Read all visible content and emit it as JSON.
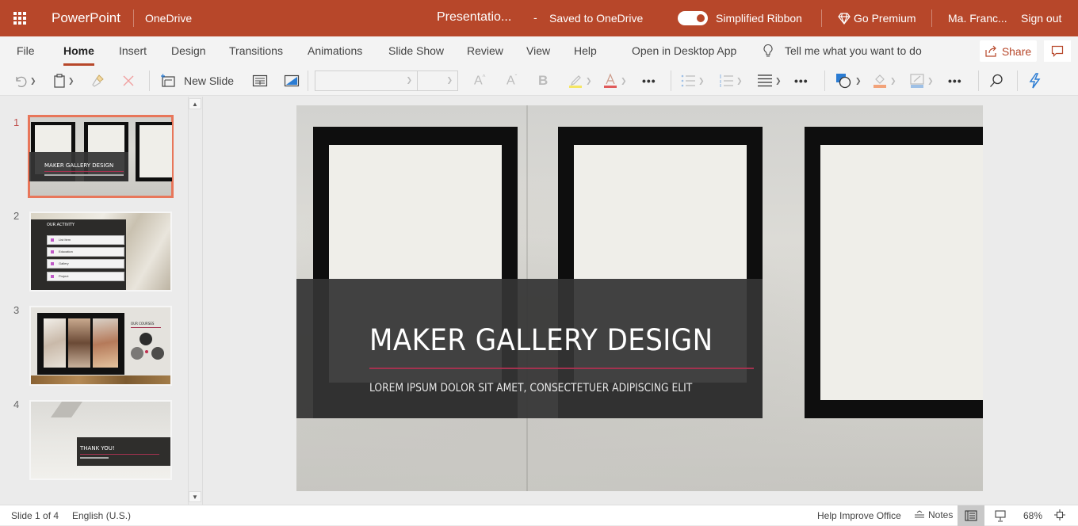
{
  "titlebar": {
    "app_launcher_icon": "waffle-grid-icon",
    "app_name": "PowerPoint",
    "location": "OneDrive",
    "document_title": "Presentatio...",
    "separator": "-",
    "save_status": "Saved to OneDrive",
    "simplified_ribbon": {
      "label": "Simplified Ribbon",
      "enabled": true
    },
    "premium": {
      "icon": "diamond-icon",
      "label": "Go Premium"
    },
    "user_name": "Ma. Franc...",
    "sign_out": "Sign out",
    "brand_color": "#b7472a"
  },
  "ribbon": {
    "tabs": [
      {
        "label": "File",
        "active": false
      },
      {
        "label": "Home",
        "active": true
      },
      {
        "label": "Insert",
        "active": false
      },
      {
        "label": "Design",
        "active": false
      },
      {
        "label": "Transitions",
        "active": false
      },
      {
        "label": "Animations",
        "active": false
      },
      {
        "label": "Slide Show",
        "active": false
      },
      {
        "label": "Review",
        "active": false
      },
      {
        "label": "View",
        "active": false
      },
      {
        "label": "Help",
        "active": false
      },
      {
        "label": "Open in Desktop App",
        "active": false
      }
    ],
    "tell_me": {
      "icon": "lightbulb-icon",
      "placeholder": "Tell me what you want to do"
    },
    "share": {
      "icon": "share-icon",
      "label": "Share"
    },
    "comments_icon": "comment-icon"
  },
  "toolbar": {
    "undo_icon": "undo-icon",
    "paste_icon": "clipboard-icon",
    "format_painter_icon": "format-painter-icon",
    "delete_icon": "delete-x-icon",
    "new_slide": {
      "icon": "new-slide-icon",
      "label": "New Slide"
    },
    "layout_icon": "layout-icon",
    "background_icon": "format-background-icon",
    "font_name": "",
    "font_size": "",
    "grow_font_icon": "increase-font-size-icon",
    "shrink_font_icon": "decrease-font-size-icon",
    "bold_label": "B",
    "highlight_icon": "highlighter-icon",
    "font_color_icon": "font-color-icon",
    "more_label": "•••",
    "bullets_icon": "bullets-icon",
    "numbering_icon": "numbering-icon",
    "align_icon": "align-icon",
    "shapes_icon": "shapes-icon",
    "shape_fill_icon": "shape-fill-icon",
    "shape_outline_icon": "shape-outline-icon",
    "find_icon": "search-icon",
    "designer_icon": "lightning-icon",
    "highlight_color": "#f5e663",
    "font_color": "#e05a5a",
    "fill_color": "#f2a37a",
    "accent_blue": "#2b7cd3"
  },
  "slides_pane": {
    "selected": 1,
    "slides": [
      {
        "number": "1",
        "title": "MAKER GALLERY DESIGN",
        "subtitle": "LOREM IPSUM DOLOR SIT AMET, CONSECTETUER ADIPISCING ELIT"
      },
      {
        "number": "2",
        "title": "OUR ACTIVITY",
        "items": [
          "List Item",
          "Education",
          "Gallery",
          "Project"
        ]
      },
      {
        "number": "3",
        "title": "OUR COURSES"
      },
      {
        "number": "4",
        "title": "THANK YOU!"
      }
    ]
  },
  "slide": {
    "title": "MAKER GALLERY DESIGN",
    "subtitle": "LOREM IPSUM DOLOR SIT AMET, CONSECTETUER ADIPISCING ELIT",
    "accent_rule_color": "#a3324f"
  },
  "statusbar": {
    "slide_position": "Slide 1 of 4",
    "language": "English (U.S.)",
    "help_improve": "Help Improve Office",
    "notes": {
      "icon": "notes-icon",
      "label": "Notes"
    },
    "normal_view_icon": "normal-view-icon",
    "slideshow_view_icon": "presenter-icon",
    "zoom": "68%",
    "fit_icon": "fit-to-window-icon"
  }
}
